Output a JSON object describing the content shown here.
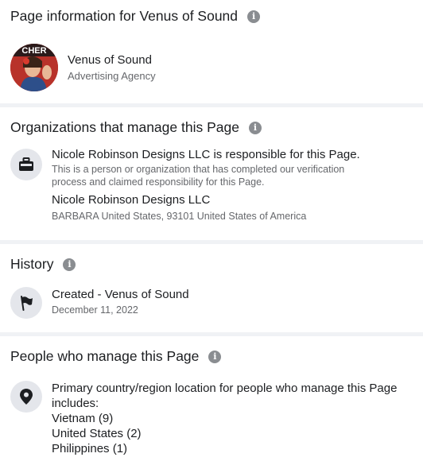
{
  "page_info": {
    "title": "Page information for Venus of Sound",
    "name": "Venus of Sound",
    "category": "Advertising Agency",
    "avatar_text": "CHER"
  },
  "organizations": {
    "title": "Organizations that manage this Page",
    "responsible": "Nicole Robinson Designs LLC is responsible for this Page.",
    "description_line1": "This is a person or organization that has completed our verification",
    "description_line2": "process and claimed responsibility for this Page.",
    "org_name": "Nicole Robinson Designs LLC",
    "address": "BARBARA United States, 93101 United States of America"
  },
  "history": {
    "title": "History",
    "event": "Created - Venus of Sound",
    "date": "December 11, 2022"
  },
  "people": {
    "title": "People who manage this Page",
    "intro_line1": "Primary country/region location for people who manage this Page",
    "intro_line2": "includes:",
    "countries": [
      "Vietnam (9)",
      "United States (2)",
      "Philippines (1)"
    ]
  },
  "icons": {
    "info": "info-icon",
    "briefcase": "briefcase-icon",
    "flag": "flag-icon",
    "location": "location-pin-icon"
  }
}
